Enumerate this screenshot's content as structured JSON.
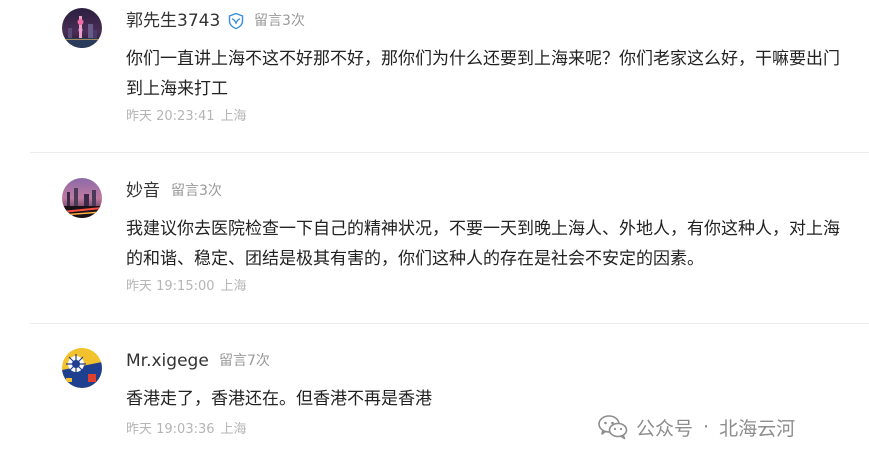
{
  "comments": [
    {
      "name": "郭先生3743",
      "badge_icon": "verified-shield-icon",
      "count": "留言3次",
      "text": "你们一直讲上海不这不好那不好，那你们为什么还要到上海来呢？你们老家这么好，干嘛要出门到上海来打工",
      "time": "昨天 20:23:41",
      "location": "上海"
    },
    {
      "name": "妙音",
      "count": "留言3次",
      "text": "我建议你去医院检查一下自己的精神状况，不要一天到晚上海人、外地人，有你这种人，对上海的和谐、稳定、团结是极其有害的，你们这种人的存在是社会不安定的因素。",
      "time": "昨天 19:15:00",
      "location": "上海"
    },
    {
      "name": "Mr.xigege",
      "count": "留言7次",
      "text": "香港走了，香港还在。但香港不再是香港",
      "time": "昨天 19:03:36",
      "location": "上海"
    }
  ],
  "watermark": {
    "icon": "wechat-icon",
    "label": "公众号",
    "separator": "·",
    "account": "北海云河"
  },
  "colors": {
    "meta": "#b5b5b5",
    "count": "#999999",
    "verified": "#3b8fd9"
  }
}
